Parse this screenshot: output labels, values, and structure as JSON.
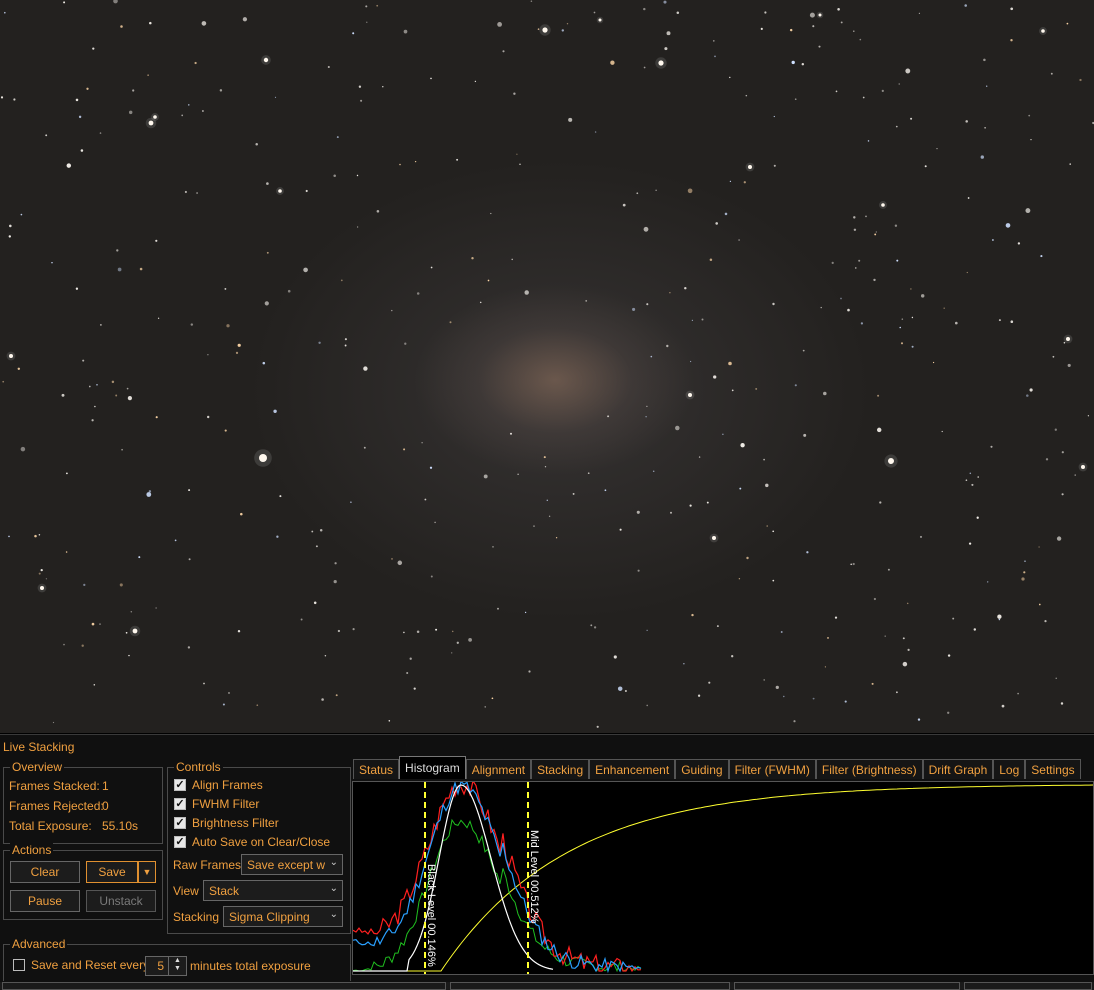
{
  "panel": {
    "title": "Live Stacking",
    "overview": {
      "label": "Overview",
      "frames_stacked_label": "Frames Stacked:",
      "frames_stacked_value": "1",
      "frames_rejected_label": "Frames Rejected:",
      "frames_rejected_value": "0",
      "total_exposure_label": "Total Exposure:",
      "total_exposure_value": "55.10s"
    },
    "actions": {
      "label": "Actions",
      "clear": "Clear",
      "save": "Save",
      "pause": "Pause",
      "unstack": "Unstack"
    },
    "controls": {
      "label": "Controls",
      "align_frames": "Align Frames",
      "fwhm_filter": "FWHM Filter",
      "brightness_filter": "Brightness Filter",
      "auto_save": "Auto Save on Clear/Close",
      "raw_frames_label": "Raw Frames",
      "raw_frames_value": "Save except w",
      "view_label": "View",
      "view_value": "Stack",
      "stacking_label": "Stacking",
      "stacking_value": "Sigma Clipping"
    },
    "advanced": {
      "label": "Advanced",
      "save_reset_label": "Save and Reset every",
      "minutes_value": "5",
      "minutes_suffix": "minutes total exposure"
    },
    "tabs": [
      "Status",
      "Histogram",
      "Alignment",
      "Stacking",
      "Enhancement",
      "Guiding",
      "Filter (FWHM)",
      "Filter (Brightness)",
      "Drift Graph",
      "Log",
      "Settings"
    ],
    "active_tab": "Histogram",
    "histogram": {
      "black_level_label": "Black Level  00.146%",
      "mid_level_label": "Mid Level  00.512%"
    }
  },
  "colors": {
    "accent": "#f0a040",
    "red": "#ff2020",
    "green": "#20c020",
    "blue": "#2aa0ff",
    "white": "#ffffff",
    "yellow": "#ffff30"
  }
}
